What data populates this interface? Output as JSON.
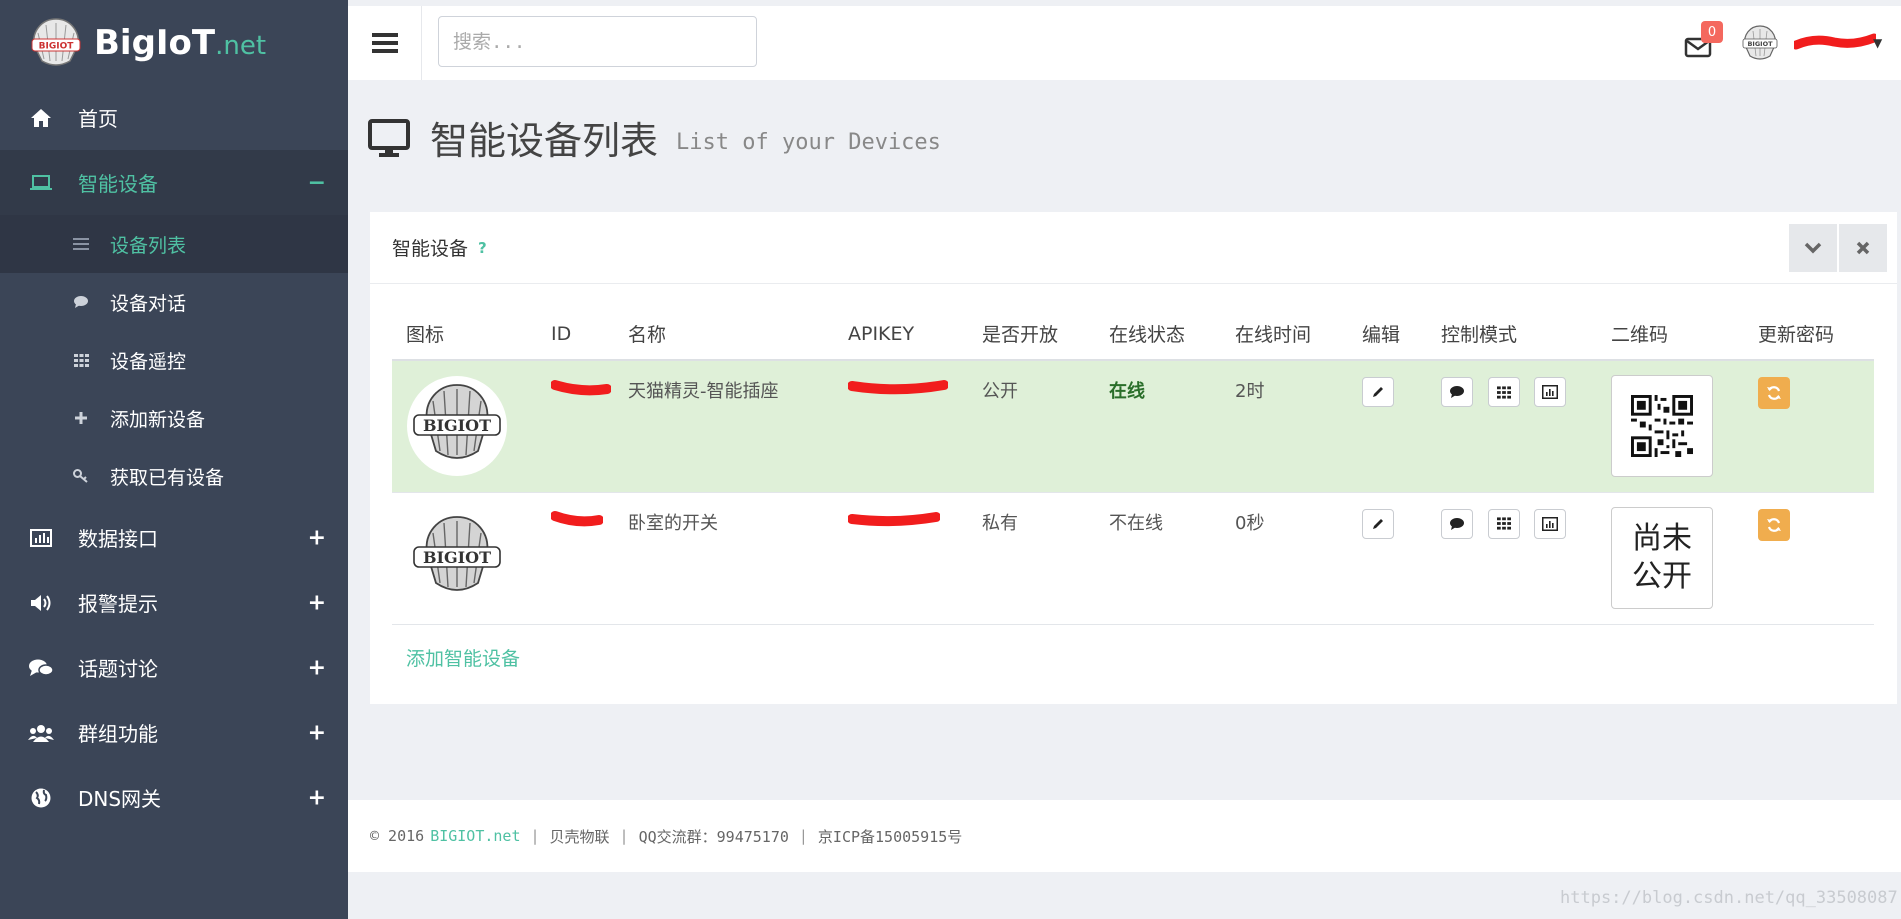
{
  "brand": {
    "name": "BigIoT",
    "tld": ".net",
    "logo_text": "BIGIOT"
  },
  "topbar": {
    "search_placeholder": "搜索...",
    "mail_count": "0"
  },
  "sidebar": {
    "items": [
      {
        "label": "首页",
        "icon": "home-icon",
        "toggle": ""
      },
      {
        "label": "智能设备",
        "icon": "laptop-icon",
        "toggle": "−"
      },
      {
        "label": "数据接口",
        "icon": "bar-chart-icon",
        "toggle": "+"
      },
      {
        "label": "报警提示",
        "icon": "volume-icon",
        "toggle": "+"
      },
      {
        "label": "话题讨论",
        "icon": "comments-icon",
        "toggle": "+"
      },
      {
        "label": "群组功能",
        "icon": "users-icon",
        "toggle": "+"
      },
      {
        "label": "DNS网关",
        "icon": "globe-icon",
        "toggle": "+"
      }
    ],
    "sub_items": [
      {
        "label": "设备列表",
        "icon": "list-icon"
      },
      {
        "label": "设备对话",
        "icon": "chat-icon"
      },
      {
        "label": "设备遥控",
        "icon": "grid-icon"
      },
      {
        "label": "添加新设备",
        "icon": "plus-icon"
      },
      {
        "label": "获取已有设备",
        "icon": "key-icon"
      }
    ]
  },
  "page": {
    "title": "智能设备列表",
    "subtitle": "List of your Devices"
  },
  "panel": {
    "title": "智能设备",
    "help": "?",
    "add_link": "添加智能设备"
  },
  "table": {
    "headers": [
      "图标",
      "ID",
      "名称",
      "APIKEY",
      "是否开放",
      "在线状态",
      "在线时间",
      "编辑",
      "控制模式",
      "二维码",
      "更新密码"
    ],
    "rows": [
      {
        "name": "天猫精灵-智能插座",
        "public": "公开",
        "status": "在线",
        "online_time": "2时",
        "qr": ""
      },
      {
        "name": "卧室的开关",
        "public": "私有",
        "status": "不在线",
        "online_time": "0秒",
        "qr_line1": "尚未",
        "qr_line2": "公开"
      }
    ]
  },
  "footer": {
    "copyright": "© 2016",
    "brand": "BIGIOT.net",
    "company": "贝壳物联",
    "qq": "QQ交流群：99475170",
    "icp": "京ICP备15005915号"
  },
  "watermark": "https://blog.csdn.net/qq_33508087",
  "colors": {
    "sidebar_bg": "#3b4557",
    "accent": "#4fc1a3",
    "online_row": "#dff0d8",
    "badge": "#f4685e",
    "refresh": "#f0ad4e",
    "redaction": "#f11d1d"
  }
}
